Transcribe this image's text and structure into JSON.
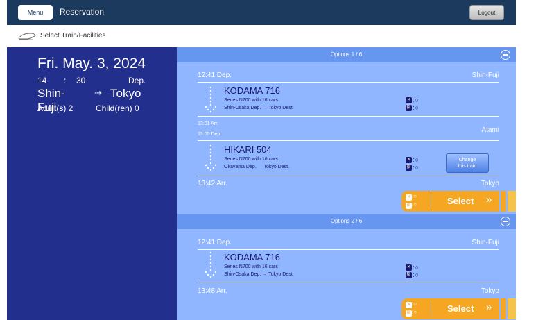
{
  "header": {
    "menu_label": "Menu",
    "title": "Reservation",
    "logout_label": "Logout"
  },
  "breadcrumb": {
    "label": "Select Train/Facilities"
  },
  "summary": {
    "date": "Fri. May. 3, 2024",
    "hour": "14",
    "colon": ":",
    "minute": "30",
    "time_type": "Dep.",
    "from": "Shin-Fuji",
    "to": "Tokyo",
    "adults": "Adult(s) 2",
    "children": "Child(ren) 0"
  },
  "options": [
    {
      "title": "Options 1 / 6",
      "departure_time": "12:41 Dep.",
      "departure_station": "Shin-Fuji",
      "trains": [
        {
          "name": "KODAMA 716",
          "cars": "Series N700 with 16 cars",
          "route": "Shin-Osaka Dep. → Tokyo Dest.",
          "seat_nonreserved": "○",
          "seat_reserved": "○"
        },
        {
          "name": "HIKARI 504",
          "cars": "Series N700 with 16 cars",
          "route": "Okayama Dep. → Tokyo Dest.",
          "seat_nonreserved": "○",
          "seat_reserved": "○"
        }
      ],
      "transfer": {
        "arrival": "13:01 Arr.",
        "departure": "13:05 Dep.",
        "station": "Atami"
      },
      "change_train_label_1": "Change",
      "change_train_label_2": "this train",
      "arrival_time": "13:42 Arr.",
      "arrival_station": "Tokyo",
      "select_label": "Select",
      "select_seat_nonreserved": "○",
      "select_seat_reserved": "○"
    },
    {
      "title": "Options 2 / 6",
      "departure_time": "12:41 Dep.",
      "departure_station": "Shin-Fuji",
      "trains": [
        {
          "name": "KODAMA 716",
          "cars": "Series N700 with 16 cars",
          "route": "Shin-Osaka Dep. → Tokyo Dest.",
          "seat_nonreserved": "○",
          "seat_reserved": "○"
        }
      ],
      "arrival_time": "13:48 Arr.",
      "arrival_station": "Tokyo",
      "select_label": "Select",
      "select_seat_nonreserved": "○",
      "select_seat_reserved": "○"
    }
  ],
  "glyphs": {
    "route_arrow": "⇢",
    "select_chevron": "»",
    "nonreserved_mark": "✕",
    "reserved_mark": "指",
    "seat_separator": ":"
  },
  "colors": {
    "header_bg": "#1c3a5e",
    "left_panel_bg": "#232f8c",
    "options_bg": "#8fb6ff",
    "option_header_bg": "#6696f0",
    "select_orange": "#f5a623"
  }
}
